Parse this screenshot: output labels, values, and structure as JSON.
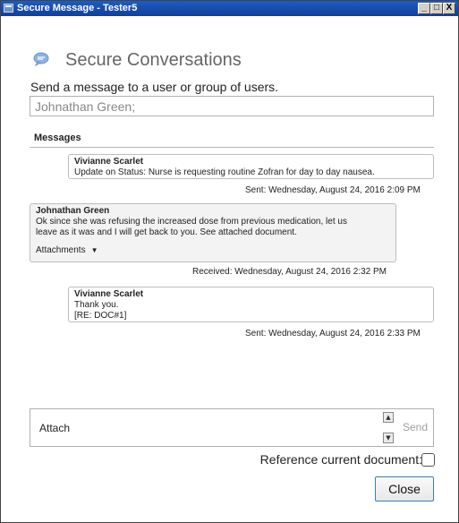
{
  "window": {
    "title": "Secure Message - Tester5",
    "controls": {
      "minimize": "_",
      "maximize": "□",
      "close": "X"
    }
  },
  "header": {
    "title": "Secure Conversations",
    "subtitle": "Send a message to a user or group of users."
  },
  "recipients": {
    "value": "Johnathan Green;"
  },
  "messages": {
    "label": "Messages",
    "items": [
      {
        "type": "sent",
        "sender": "Vivianne Scarlet",
        "lines": [
          "Update on Status:  Nurse is requesting routine Zofran for day to day nausea."
        ],
        "timestamp": "Sent: Wednesday, August 24, 2016 2:09 PM"
      },
      {
        "type": "received",
        "sender": "Johnathan Green",
        "lines": [
          "Ok since she was refusing the increased dose from previous medication, let us",
          "leave as it was and I will get back to you.  See attached document."
        ],
        "attachments_label": "Attachments",
        "timestamp": "Received: Wednesday, August 24, 2016 2:32 PM"
      },
      {
        "type": "sent",
        "sender": "Vivianne Scarlet",
        "lines": [
          "Thank you.",
          "[RE: DOC#1]"
        ],
        "timestamp": "Sent: Wednesday, August 24, 2016 2:33 PM"
      }
    ]
  },
  "compose": {
    "placeholder": "Attach",
    "send_label": "Send"
  },
  "reference": {
    "label": "Reference current document:",
    "checked": false
  },
  "close_label": "Close",
  "icons": {
    "app": "app-window-icon",
    "chat": "chat-bubble-icon",
    "scroll_up": "scroll-up-icon",
    "scroll_down": "scroll-down-icon",
    "dropdown": "chevron-down-icon"
  },
  "colors": {
    "titlebar": "#1e5cc0",
    "close_border": "#3c7fb1",
    "chat_icon": "#8fb3e3"
  }
}
